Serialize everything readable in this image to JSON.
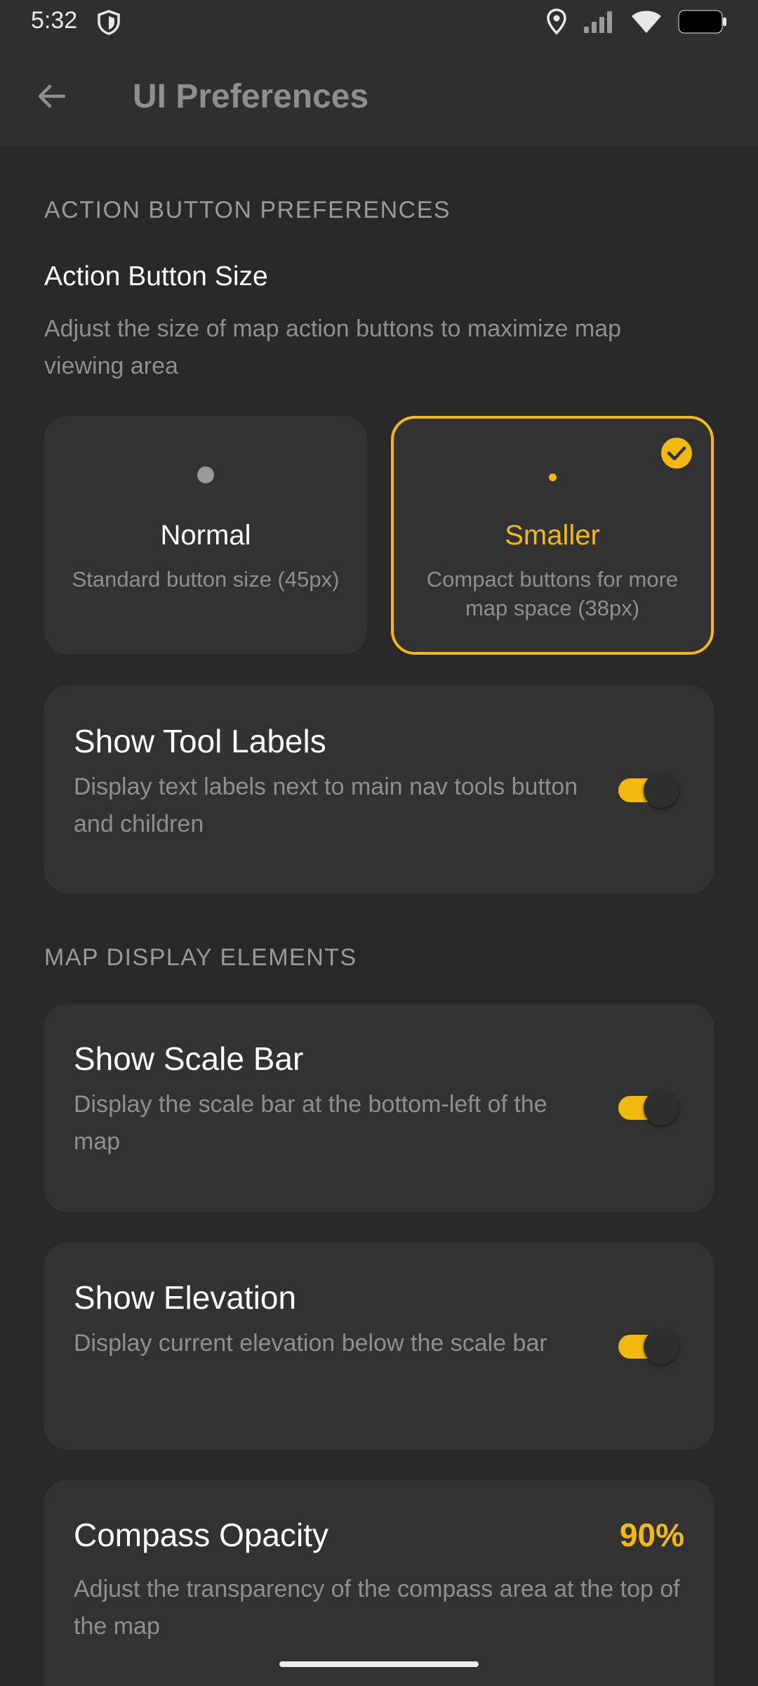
{
  "status_bar": {
    "time": "5:32",
    "icons": [
      "shield-icon",
      "location-icon",
      "cell-signal-icon",
      "wifi-icon",
      "battery-icon"
    ]
  },
  "app_bar": {
    "title": "UI Preferences",
    "back_icon": "arrow-left-icon"
  },
  "action_button_section": {
    "header": "ACTION BUTTON PREFERENCES",
    "title": "Action Button Size",
    "description": "Adjust the size of map action buttons to maximize map viewing area",
    "options": [
      {
        "label": "Normal",
        "description": "Standard button size (45px)",
        "selected": false
      },
      {
        "label": "Smaller",
        "description": "Compact buttons for more map space (38px)",
        "selected": true
      }
    ]
  },
  "tool_labels": {
    "title": "Show Tool Labels",
    "description": "Display text labels next to main nav tools button and children",
    "enabled": true
  },
  "map_display_section": {
    "header": "MAP DISPLAY ELEMENTS",
    "items": [
      {
        "title": "Show Scale Bar",
        "description": "Display the scale bar at the bottom-left of the map",
        "enabled": true
      },
      {
        "title": "Show Elevation",
        "description": "Display current elevation below the scale bar",
        "enabled": true
      }
    ],
    "compass_opacity": {
      "title": "Compass Opacity",
      "value": "90%",
      "description": "Adjust the transparency of the compass area at the top of the map"
    }
  },
  "colors": {
    "accent": "#f2b90f",
    "background": "#282828",
    "card": "#323232"
  }
}
